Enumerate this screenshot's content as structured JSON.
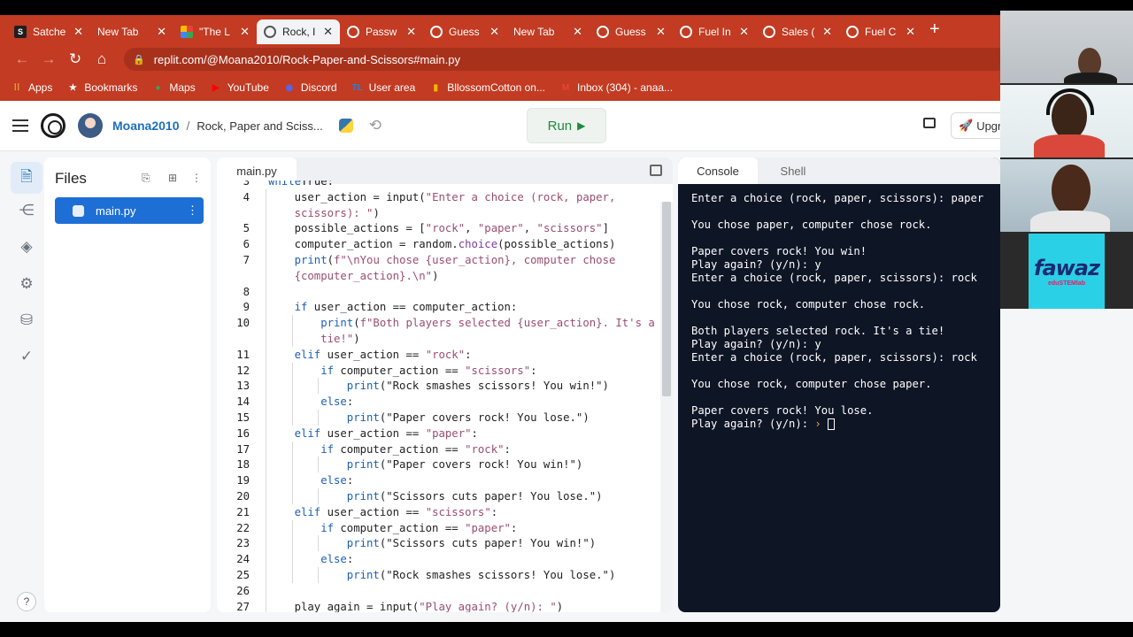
{
  "browser": {
    "tabs": [
      {
        "title": "Satche",
        "fav": "s",
        "active": false
      },
      {
        "title": "New Tab",
        "fav": "none",
        "active": false
      },
      {
        "title": "\"The L",
        "fav": "grid",
        "active": false
      },
      {
        "title": "Rock, I",
        "fav": "rep",
        "active": true
      },
      {
        "title": "Passw",
        "fav": "rep",
        "active": false
      },
      {
        "title": "Guess",
        "fav": "rep",
        "active": false
      },
      {
        "title": "New Tab",
        "fav": "none",
        "active": false
      },
      {
        "title": "Guess",
        "fav": "rep",
        "active": false
      },
      {
        "title": "Fuel In",
        "fav": "rep",
        "active": false
      },
      {
        "title": "Sales (",
        "fav": "rep",
        "active": false
      },
      {
        "title": "Fuel C",
        "fav": "rep",
        "active": false
      }
    ],
    "url": "replit.com/@Moana2010/Rock-Paper-and-Scissors#main.py",
    "bookmarks": [
      {
        "label": "Apps",
        "icon": "apps-grid-icon",
        "color": "#f1c232"
      },
      {
        "label": "Bookmarks",
        "icon": "star-icon",
        "color": "#ffffff"
      },
      {
        "label": "Maps",
        "icon": "maps-pin-icon",
        "color": "#34a853"
      },
      {
        "label": "YouTube",
        "icon": "youtube-icon",
        "color": "#ff0000"
      },
      {
        "label": "Discord",
        "icon": "discord-icon",
        "color": "#5865f2"
      },
      {
        "label": "User area",
        "icon": "tl-icon",
        "color": "#2f7fd1"
      },
      {
        "label": "BllossomCotton on...",
        "icon": "bookmark-icon",
        "color": "#f4b400"
      },
      {
        "label": "Inbox (304) - anaa...",
        "icon": "gmail-icon",
        "color": "#ea4335"
      }
    ]
  },
  "replit": {
    "user": "Moana2010",
    "repl_name": "Rock, Paper and Sciss...",
    "run_label": "Run",
    "upgrade_label": "Upgra",
    "files_title": "Files",
    "file_name": "main.py",
    "editor_tab": "main.py",
    "console_tab": "Console",
    "shell_tab": "Shell",
    "help_label": "?"
  },
  "code_lines": [
    {
      "n": "3",
      "indent": 0,
      "parts": [
        [
          "kw",
          "while"
        ],
        [
          "",
          "True:"
        ]
      ],
      "partial": true
    },
    {
      "n": "4",
      "indent": 1,
      "parts": [
        [
          "",
          "user_action = input("
        ],
        [
          "st",
          "\"Enter a choice (rock, paper,"
        ]
      ]
    },
    {
      "n": "",
      "indent": 1,
      "parts": [
        [
          "st",
          "scissors): \""
        ],
        [
          "",
          ")"
        ]
      ]
    },
    {
      "n": "5",
      "indent": 1,
      "parts": [
        [
          "",
          "possible_actions = ["
        ],
        [
          "st",
          "\"rock\""
        ],
        [
          "",
          ", "
        ],
        [
          "st",
          "\"paper\""
        ],
        [
          "",
          ", "
        ],
        [
          "st",
          "\"scissors\""
        ],
        [
          "",
          "]"
        ]
      ]
    },
    {
      "n": "6",
      "indent": 1,
      "parts": [
        [
          "",
          "computer_action = random."
        ],
        [
          "fn",
          "choice"
        ],
        [
          "",
          "(possible_actions)"
        ]
      ]
    },
    {
      "n": "7",
      "indent": 1,
      "parts": [
        [
          "kw",
          "print"
        ],
        [
          "",
          "("
        ],
        [
          "st",
          "f\"\\nYou chose {user_action}, computer chose"
        ]
      ]
    },
    {
      "n": "",
      "indent": 1,
      "parts": [
        [
          "st",
          "{computer_action}.\\n\""
        ],
        [
          "",
          ")"
        ]
      ]
    },
    {
      "n": "8",
      "indent": 1,
      "parts": []
    },
    {
      "n": "9",
      "indent": 1,
      "parts": [
        [
          "kw",
          "if"
        ],
        [
          "",
          " user_action == computer_action:"
        ]
      ]
    },
    {
      "n": "10",
      "indent": 2,
      "parts": [
        [
          "kw",
          "print"
        ],
        [
          "",
          "("
        ],
        [
          "st",
          "f\"Both players selected {user_action}. It's a"
        ]
      ]
    },
    {
      "n": "",
      "indent": 2,
      "parts": [
        [
          "st",
          "tie!\""
        ],
        [
          "",
          ")"
        ]
      ]
    },
    {
      "n": "11",
      "indent": 1,
      "parts": [
        [
          "kw",
          "elif"
        ],
        [
          "",
          " user_action == "
        ],
        [
          "st",
          "\"rock\""
        ],
        [
          "",
          ":"
        ]
      ]
    },
    {
      "n": "12",
      "indent": 2,
      "parts": [
        [
          "kw",
          "if"
        ],
        [
          "",
          " computer_action == "
        ],
        [
          "st",
          "\"scissors\""
        ],
        [
          "",
          ":"
        ]
      ]
    },
    {
      "n": "13",
      "indent": 3,
      "parts": [
        [
          "kw",
          "print"
        ],
        [
          "",
          "(\"Rock smashes scissors! You win!\")"
        ]
      ]
    },
    {
      "n": "14",
      "indent": 2,
      "parts": [
        [
          "kw",
          "else"
        ],
        [
          "",
          ":"
        ]
      ]
    },
    {
      "n": "15",
      "indent": 3,
      "parts": [
        [
          "kw",
          "print"
        ],
        [
          "",
          "(\"Paper covers rock! You lose.\")"
        ]
      ]
    },
    {
      "n": "16",
      "indent": 1,
      "parts": [
        [
          "kw",
          "elif"
        ],
        [
          "",
          " user_action == "
        ],
        [
          "st",
          "\"paper\""
        ],
        [
          "",
          ":"
        ]
      ]
    },
    {
      "n": "17",
      "indent": 2,
      "parts": [
        [
          "kw",
          "if"
        ],
        [
          "",
          " computer_action == "
        ],
        [
          "st",
          "\"rock\""
        ],
        [
          "",
          ":"
        ]
      ]
    },
    {
      "n": "18",
      "indent": 3,
      "parts": [
        [
          "kw",
          "print"
        ],
        [
          "",
          "(\"Paper covers rock! You win!\")"
        ]
      ]
    },
    {
      "n": "19",
      "indent": 2,
      "parts": [
        [
          "kw",
          "else"
        ],
        [
          "",
          ":"
        ]
      ]
    },
    {
      "n": "20",
      "indent": 3,
      "parts": [
        [
          "kw",
          "print"
        ],
        [
          "",
          "(\"Scissors cuts paper! You lose.\")"
        ]
      ]
    },
    {
      "n": "21",
      "indent": 1,
      "parts": [
        [
          "kw",
          "elif"
        ],
        [
          "",
          " user_action == "
        ],
        [
          "st",
          "\"scissors\""
        ],
        [
          "",
          ":"
        ]
      ]
    },
    {
      "n": "22",
      "indent": 2,
      "parts": [
        [
          "kw",
          "if"
        ],
        [
          "",
          " computer_action == "
        ],
        [
          "st",
          "\"paper\""
        ],
        [
          "",
          ":"
        ]
      ]
    },
    {
      "n": "23",
      "indent": 3,
      "parts": [
        [
          "kw",
          "print"
        ],
        [
          "",
          "(\"Scissors cuts paper! You win!\")"
        ]
      ]
    },
    {
      "n": "24",
      "indent": 2,
      "parts": [
        [
          "kw",
          "else"
        ],
        [
          "",
          ":"
        ]
      ]
    },
    {
      "n": "25",
      "indent": 3,
      "parts": [
        [
          "kw",
          "print"
        ],
        [
          "",
          "(\"Rock smashes scissors! You lose.\")"
        ]
      ]
    },
    {
      "n": "26",
      "indent": 1,
      "parts": []
    },
    {
      "n": "27",
      "indent": 1,
      "parts": [
        [
          "",
          "play_again = input("
        ],
        [
          "st",
          "\"Play again? (y/n): \""
        ],
        [
          "",
          ")"
        ]
      ]
    }
  ],
  "console_lines": [
    "Enter a choice (rock, paper, scissors): paper",
    "",
    "You chose paper, computer chose rock.",
    "",
    "Paper covers rock! You win!",
    "Play again? (y/n): y",
    "Enter a choice (rock, paper, scissors): rock",
    "",
    "You chose rock, computer chose rock.",
    "",
    "Both players selected rock. It's a tie!",
    "Play again? (y/n): y",
    "Enter a choice (rock, paper, scissors): rock",
    "",
    "You chose rock, computer chose paper.",
    "",
    "Paper covers rock! You lose."
  ],
  "console_prompt": "Play again? (y/n): ",
  "console_prompt_marker": "›",
  "overlay": {
    "logo_text": "fawaz",
    "logo_sub": "eduSTEMlab"
  }
}
